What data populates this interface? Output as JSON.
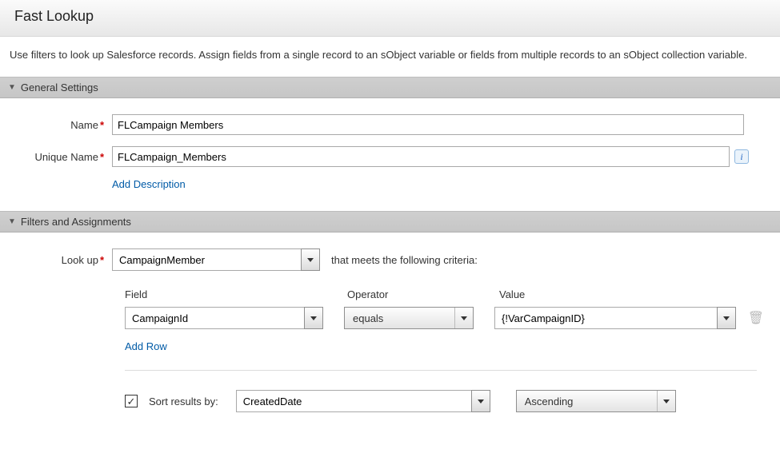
{
  "title": "Fast Lookup",
  "intro": "Use filters to look up Salesforce records. Assign fields from a single record to an sObject variable or fields from multiple records to an sObject collection variable.",
  "sections": {
    "general": "General Settings",
    "filters": "Filters and Assignments"
  },
  "general": {
    "name_label": "Name",
    "name_value": "FLCampaign Members",
    "unique_label": "Unique Name",
    "unique_value": "FLCampaign_Members",
    "add_desc": "Add Description"
  },
  "filters": {
    "lookup_label": "Look up",
    "lookup_value": "CampaignMember",
    "criteria_text": "that meets the following criteria:",
    "headers": {
      "field": "Field",
      "operator": "Operator",
      "value": "Value"
    },
    "row": {
      "field": "CampaignId",
      "operator": "equals",
      "value": "{!VarCampaignID}"
    },
    "add_row": "Add Row",
    "sort_label": "Sort results by:",
    "sort_field": "CreatedDate",
    "sort_dir": "Ascending",
    "sort_checked": true
  },
  "glyphs": {
    "info": "i",
    "check": "✓"
  }
}
